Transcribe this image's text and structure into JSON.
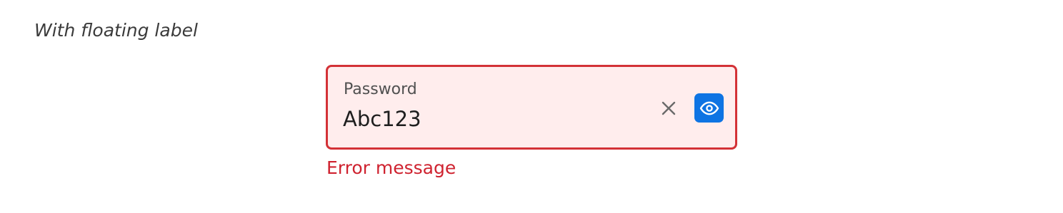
{
  "section": {
    "title": "With floating label"
  },
  "password_field": {
    "label": "Password",
    "value": "Abc123",
    "error_message": "Error message",
    "clear_icon": "close-icon",
    "visibility_icon": "eye-icon",
    "colors": {
      "error": "#d33136",
      "error_background": "#ffeded",
      "accent": "#0e74e3"
    }
  }
}
